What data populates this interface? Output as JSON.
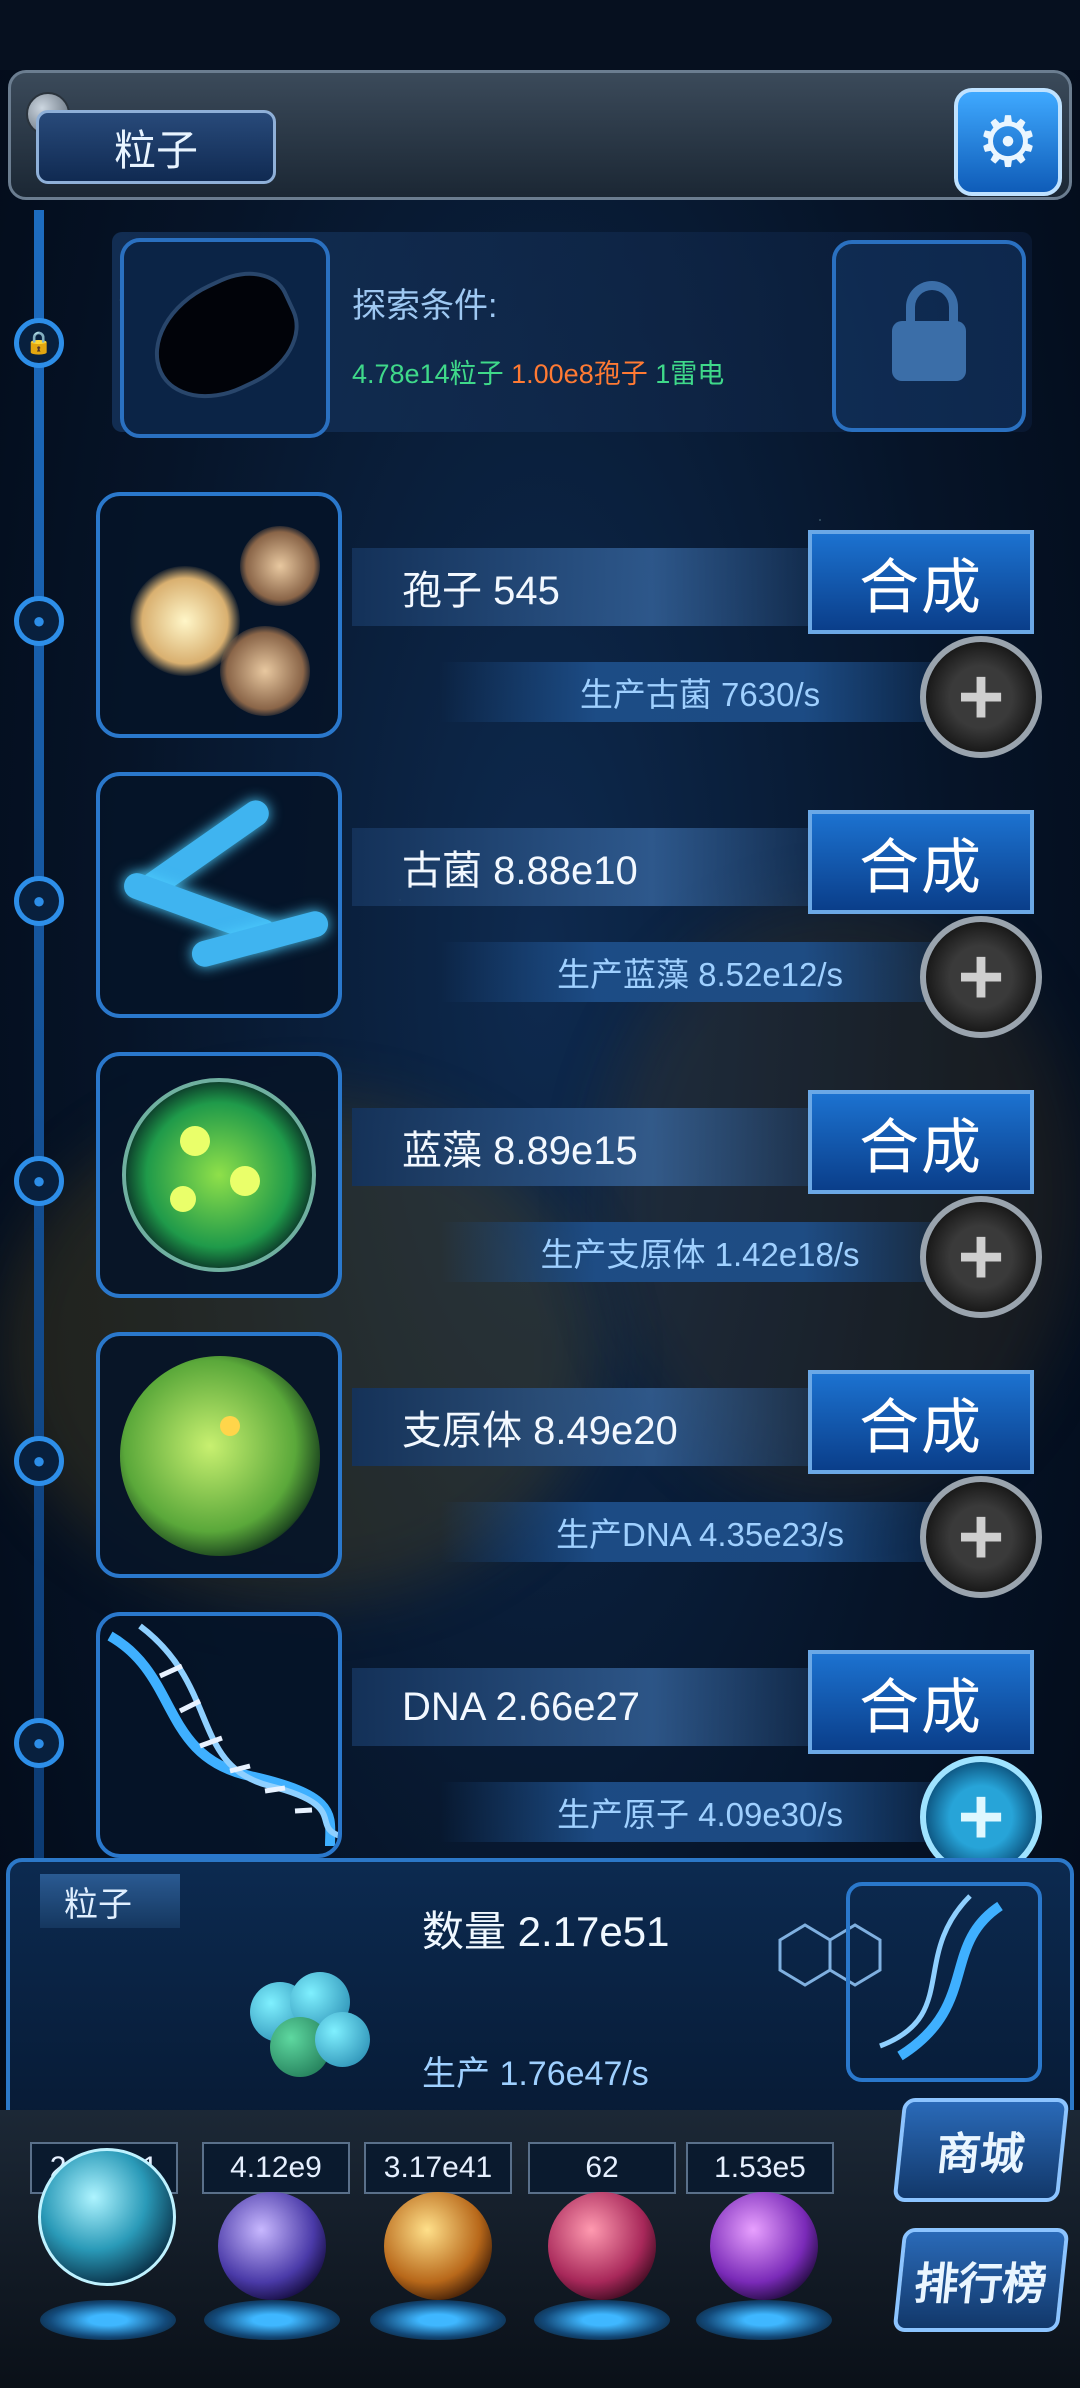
{
  "header": {
    "title": "粒子",
    "settings_icon": "gear-icon"
  },
  "explore": {
    "label": "探索条件:",
    "requirements": [
      "4.78e14粒子",
      "1.00e8孢子",
      "1雷电"
    ],
    "locked": true
  },
  "units": [
    {
      "name_count": "孢子 545",
      "synth_label": "合成",
      "production": "生产古菌 7630/s"
    },
    {
      "name_count": "古菌 8.88e10",
      "synth_label": "合成",
      "production": "生产蓝藻 8.52e12/s"
    },
    {
      "name_count": "蓝藻 8.89e15",
      "synth_label": "合成",
      "production": "生产支原体 1.42e18/s"
    },
    {
      "name_count": "支原体 8.49e20",
      "synth_label": "合成",
      "production": "生产DNA 4.35e23/s"
    },
    {
      "name_count": "DNA 2.66e27",
      "synth_label": "合成",
      "production": "生产原子 4.09e30/s"
    }
  ],
  "summary": {
    "tag": "粒子",
    "count": "数量 2.17e51",
    "rate": "生产 1.76e47/s"
  },
  "dock": {
    "counters": [
      "2.17e51",
      "4.12e9",
      "3.17e41",
      "62",
      "1.53e5"
    ],
    "shop_label": "商城",
    "rank_label": "排行榜"
  },
  "colors": {
    "accent": "#1c72d0",
    "req_green": "#3fd98a",
    "req_orange": "#ff7a33"
  }
}
